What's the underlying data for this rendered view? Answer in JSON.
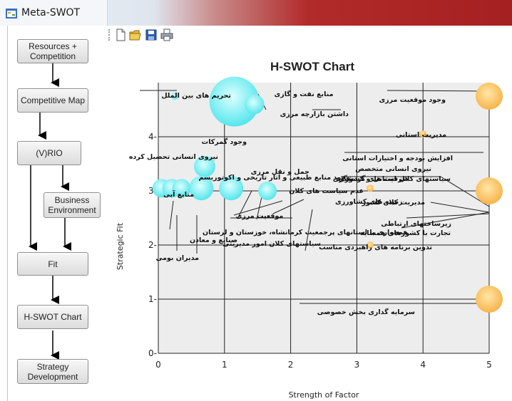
{
  "window": {
    "title": "Meta-SWOT"
  },
  "sidebar": {
    "buttons": [
      {
        "label": "Resources +\nCompetition"
      },
      {
        "label": "Competitive Map"
      },
      {
        "label": "(V)RIO"
      },
      {
        "label": "Business\nEnvironment"
      },
      {
        "label": "Fit"
      },
      {
        "label": "H-SWOT Chart"
      },
      {
        "label": "Strategy\nDevelopment"
      }
    ]
  },
  "toolbar": {
    "icons": [
      "new-file-icon",
      "open-folder-icon",
      "save-icon",
      "print-icon"
    ]
  },
  "chart_data": {
    "type": "scatter",
    "title": "H-SWOT Chart",
    "xlabel": "Strength of Factor",
    "ylabel": "Strategic Fit",
    "xlim": [
      0,
      5
    ],
    "ylim": [
      0,
      5
    ],
    "xticks": [
      "0",
      "1",
      "2",
      "3",
      "4",
      "5"
    ],
    "yticks": [
      "0-",
      "1-",
      "2-",
      "3-",
      "4-"
    ],
    "grid": true,
    "series": [
      {
        "color": "#7ff0f0",
        "points": [
          {
            "x": 0.25,
            "y": 4.75,
            "size": 5
          },
          {
            "x": 1.15,
            "y": 4.65,
            "size": 35
          },
          {
            "x": 1.45,
            "y": 4.6,
            "size": 14
          },
          {
            "x": 0.7,
            "y": 3.45,
            "size": 15
          },
          {
            "x": 0.05,
            "y": 3.05,
            "size": 13
          },
          {
            "x": 0.2,
            "y": 3.05,
            "size": 13
          },
          {
            "x": 0.35,
            "y": 3.05,
            "size": 13
          },
          {
            "x": 0.65,
            "y": 3.05,
            "size": 17
          },
          {
            "x": 1.1,
            "y": 3.05,
            "size": 17
          },
          {
            "x": 1.65,
            "y": 3.0,
            "size": 13
          }
        ]
      },
      {
        "color": "#ffc45e",
        "points": [
          {
            "x": 5.0,
            "y": 4.75,
            "size": 19
          },
          {
            "x": 4.0,
            "y": 4.05,
            "size": 5
          },
          {
            "x": 3.2,
            "y": 3.05,
            "size": 5
          },
          {
            "x": 5.0,
            "y": 3.0,
            "size": 19
          },
          {
            "x": 3.2,
            "y": 2.0,
            "size": 5
          },
          {
            "x": 5.0,
            "y": 1.0,
            "size": 19
          }
        ]
      }
    ],
    "annotations": [
      "تحریم های بین الملل",
      "منابع نفت و گازی",
      "داشتن بازارچه مرزی",
      "وجود گمرکات",
      "نیروی انسانی تحصیل کرده",
      "منابع آبی",
      "حمل و نقل مرزی",
      "وجود منابع طبیعی و آثار تاریخی و اکوتوریسم",
      "ظرفیت های گردشگری",
      "عدم سیاست های کلان",
      "زمینه های کشاورزی",
      "موقعیت مرزی",
      "همجواری با استانهای پرجمعیت کرمانشاه، خوزستان و لرستان",
      "سیاستهای کلان امور مدیریتی",
      "مدیران بومی",
      "صنایع و معادن",
      "وجود موقعیت مرزی",
      "مدیریت استانی",
      "افزایش بودجه و اختیارات استانی",
      "نیروی انسانی متخصص",
      "سیاستهای کلان استانی و کشوری",
      "مدیریت کلان کشور",
      "زیرساختهای ارتباطی",
      "تجارت با کشورهای همسایه",
      "تدوین برنامه های راهبردی مناسب",
      "سرمایه گذاری بخش خصوصی"
    ]
  }
}
